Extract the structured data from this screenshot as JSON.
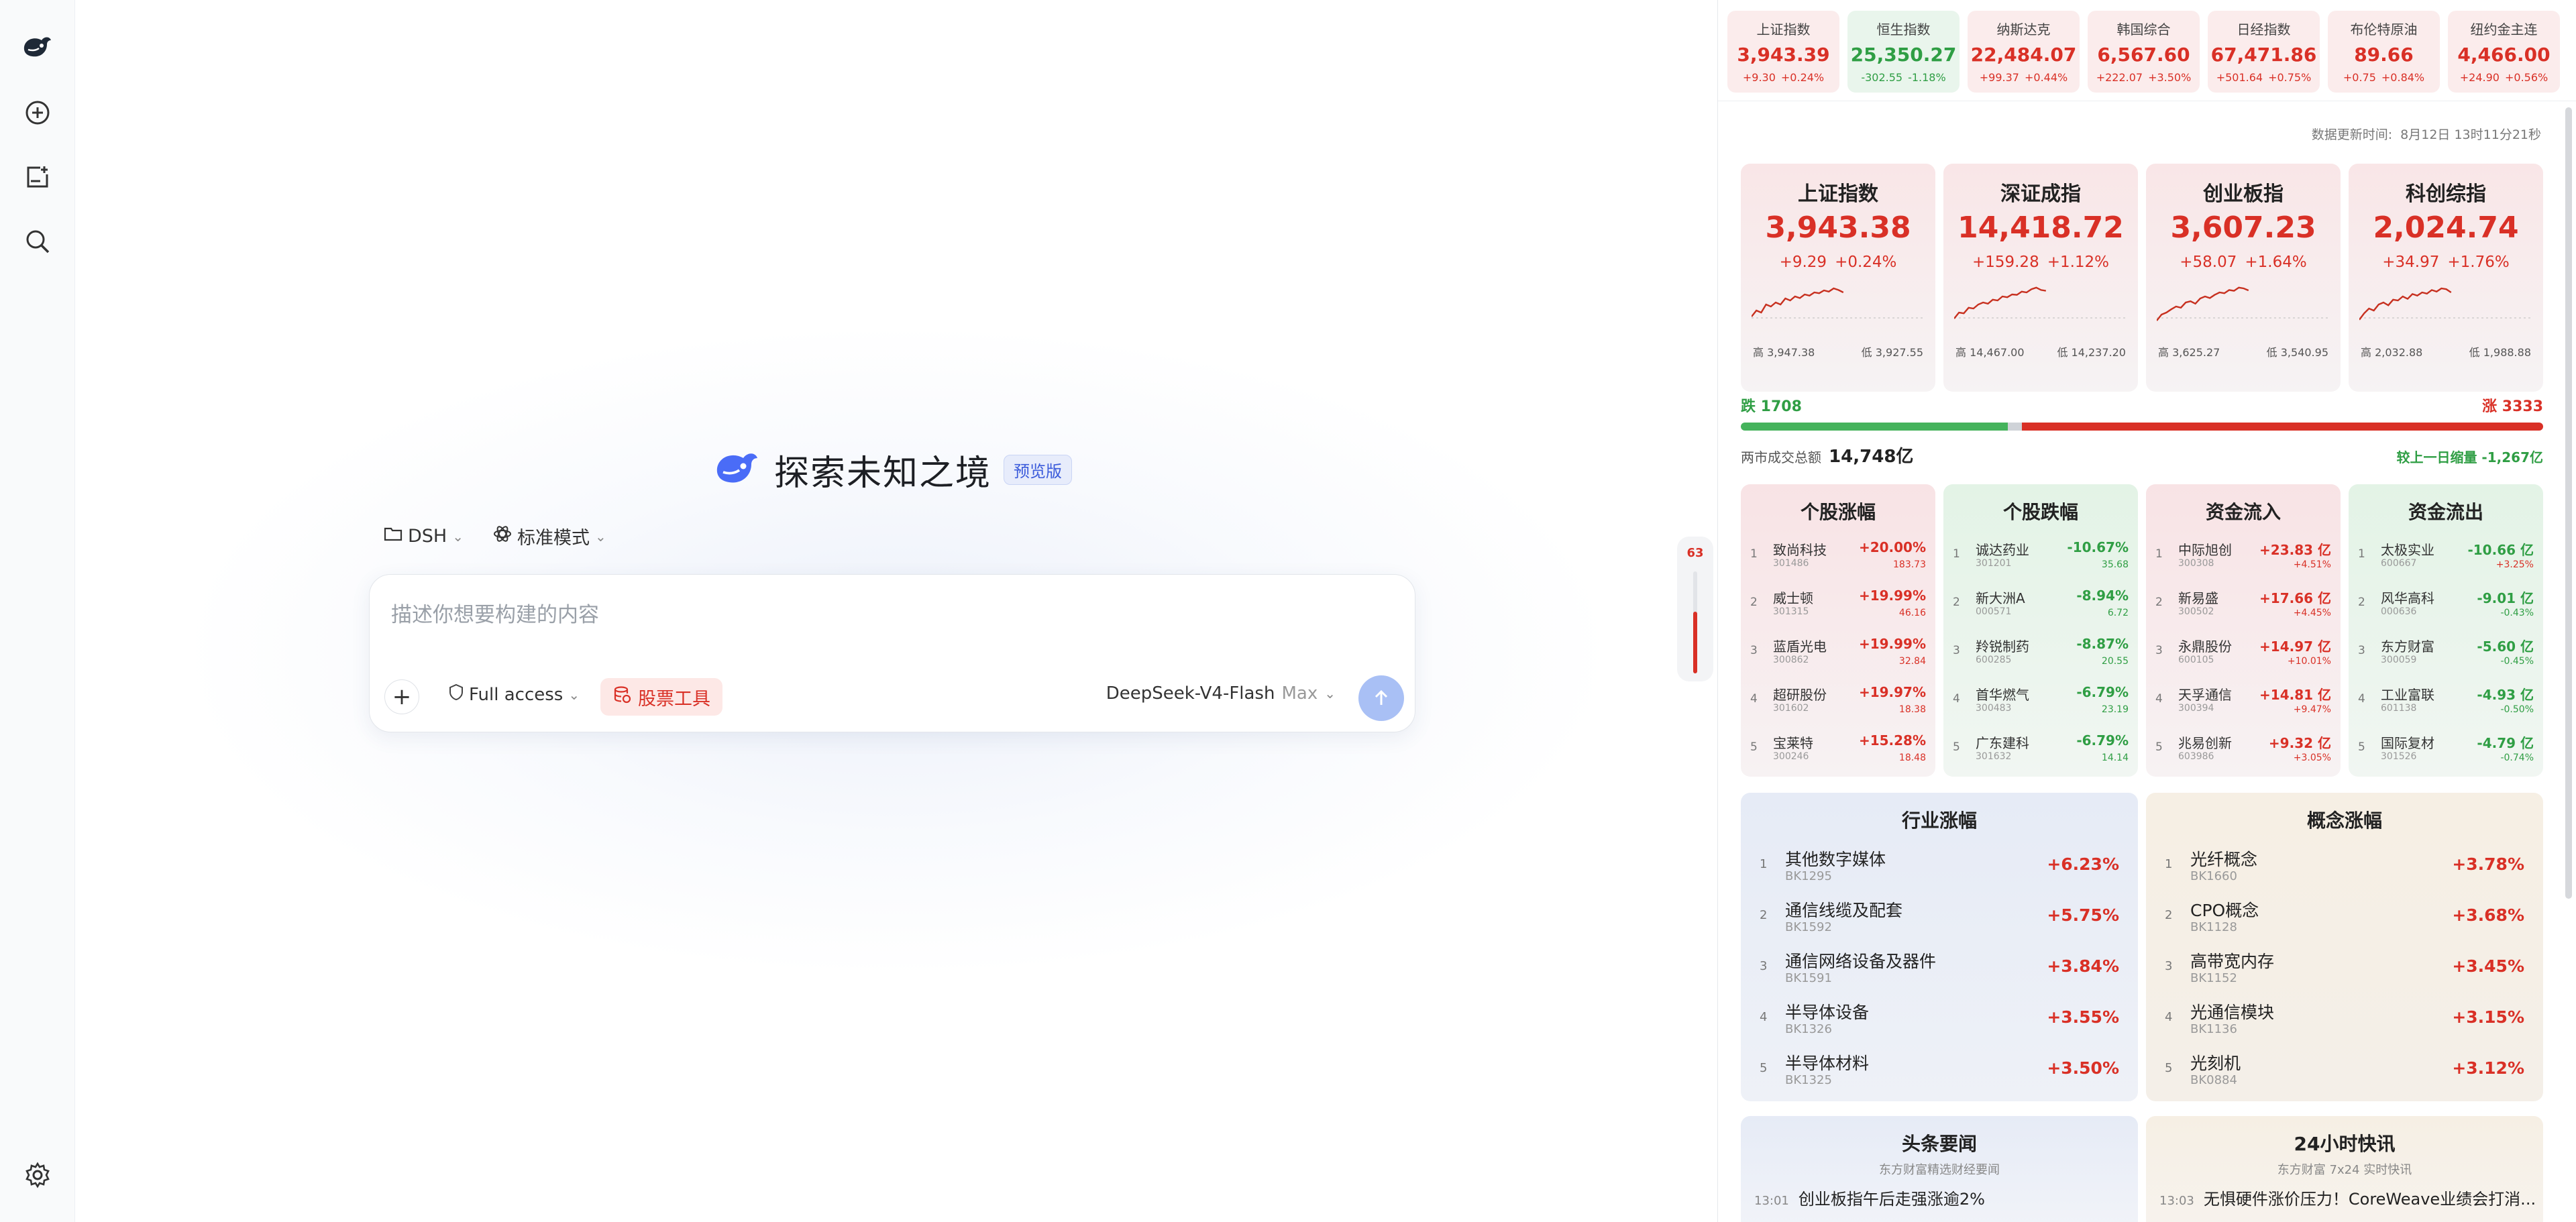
{
  "sidebar": {
    "icons": [
      "whale-logo-icon",
      "new-chat-icon",
      "new-project-icon",
      "search-icon",
      "settings-icon"
    ]
  },
  "main": {
    "title": "探索未知之境",
    "badge": "预览版",
    "workspace": "DSH",
    "mode": "标准模式",
    "input_placeholder": "描述你想要构建的内容",
    "access": "Full access",
    "tool": "股票工具",
    "model": "DeepSeek-V4-Flash",
    "model_tier": "Max",
    "scroll_count": "63"
  },
  "ticker": [
    {
      "name": "上证指数",
      "value": "3,943.39",
      "change": "+9.30",
      "pct": "+0.24%",
      "dir": "up"
    },
    {
      "name": "恒生指数",
      "value": "25,350.27",
      "change": "-302.55",
      "pct": "-1.18%",
      "dir": "dn"
    },
    {
      "name": "纳斯达克",
      "value": "22,484.07",
      "change": "+99.37",
      "pct": "+0.44%",
      "dir": "up"
    },
    {
      "name": "韩国综合",
      "value": "6,567.60",
      "change": "+222.07",
      "pct": "+3.50%",
      "dir": "up"
    },
    {
      "name": "日经指数",
      "value": "67,471.86",
      "change": "+501.64",
      "pct": "+0.75%",
      "dir": "up"
    },
    {
      "name": "布伦特原油",
      "value": "89.66",
      "change": "+0.75",
      "pct": "+0.84%",
      "dir": "up"
    },
    {
      "name": "纽约金主连",
      "value": "4,466.00",
      "change": "+24.90",
      "pct": "+0.56%",
      "dir": "up"
    }
  ],
  "update": {
    "label": "数据更新时间:",
    "time": "8月12日 13时11分21秒"
  },
  "indices": [
    {
      "name": "上证指数",
      "value": "3,943.38",
      "change": "+9.29",
      "pct": "+0.24%",
      "high": "高 3,947.38",
      "low": "低 3,927.55"
    },
    {
      "name": "深证成指",
      "value": "14,418.72",
      "change": "+159.28",
      "pct": "+1.12%",
      "high": "高 14,467.00",
      "low": "低 14,237.20"
    },
    {
      "name": "创业板指",
      "value": "3,607.23",
      "change": "+58.07",
      "pct": "+1.64%",
      "high": "高 3,625.27",
      "low": "低 3,540.95"
    },
    {
      "name": "科创综指",
      "value": "2,024.74",
      "change": "+34.97",
      "pct": "+1.76%",
      "high": "高 2,032.88",
      "low": "低 1,988.88"
    }
  ],
  "breadth": {
    "down_label": "跌 1708",
    "up_label": "涨 3333",
    "down": 1708,
    "up": 3333,
    "flat": 90,
    "turnover_label": "两市成交总额",
    "turnover": "14,748亿",
    "compare": "较上一日缩量 -1,267亿"
  },
  "movers": [
    {
      "title": "个股涨幅",
      "dir": "up",
      "items": [
        {
          "name": "致尚科技",
          "code": "301486",
          "pct": "+20.00%",
          "sub": "183.73"
        },
        {
          "name": "威士顿",
          "code": "301315",
          "pct": "+19.99%",
          "sub": "46.16"
        },
        {
          "name": "蓝盾光电",
          "code": "300862",
          "pct": "+19.99%",
          "sub": "32.84"
        },
        {
          "name": "超研股份",
          "code": "301602",
          "pct": "+19.97%",
          "sub": "18.38"
        },
        {
          "name": "宝莱特",
          "code": "300246",
          "pct": "+15.28%",
          "sub": "18.48"
        }
      ]
    },
    {
      "title": "个股跌幅",
      "dir": "dn",
      "items": [
        {
          "name": "诚达药业",
          "code": "301201",
          "pct": "-10.67%",
          "sub": "35.68"
        },
        {
          "name": "新大洲A",
          "code": "000571",
          "pct": "-8.94%",
          "sub": "6.72"
        },
        {
          "name": "羚锐制药",
          "code": "600285",
          "pct": "-8.87%",
          "sub": "20.55"
        },
        {
          "name": "首华燃气",
          "code": "300483",
          "pct": "-6.79%",
          "sub": "23.19"
        },
        {
          "name": "广东建科",
          "code": "301632",
          "pct": "-6.79%",
          "sub": "14.14"
        }
      ]
    },
    {
      "title": "资金流入",
      "dir": "up",
      "items": [
        {
          "name": "中际旭创",
          "code": "300308",
          "pct": "+23.83 亿",
          "sub": "+4.51%"
        },
        {
          "name": "新易盛",
          "code": "300502",
          "pct": "+17.66 亿",
          "sub": "+4.45%"
        },
        {
          "name": "永鼎股份",
          "code": "600105",
          "pct": "+14.97 亿",
          "sub": "+10.01%"
        },
        {
          "name": "天孚通信",
          "code": "300394",
          "pct": "+14.81 亿",
          "sub": "+9.47%"
        },
        {
          "name": "兆易创新",
          "code": "603986",
          "pct": "+9.32 亿",
          "sub": "+3.05%"
        }
      ]
    },
    {
      "title": "资金流出",
      "dir": "dn",
      "items": [
        {
          "name": "太极实业",
          "code": "600667",
          "pct": "-10.66 亿",
          "sub": "+3.25%"
        },
        {
          "name": "风华高科",
          "code": "000636",
          "pct": "-9.01 亿",
          "sub": "-0.43%"
        },
        {
          "name": "东方财富",
          "code": "300059",
          "pct": "-5.60 亿",
          "sub": "-0.45%"
        },
        {
          "name": "工业富联",
          "code": "601138",
          "pct": "-4.93 亿",
          "sub": "-0.50%"
        },
        {
          "name": "国际复材",
          "code": "301526",
          "pct": "-4.79 亿",
          "sub": "-0.74%"
        }
      ]
    }
  ],
  "boards": [
    {
      "title": "行业涨幅",
      "kind": "ind",
      "items": [
        {
          "name": "其他数字媒体",
          "code": "BK1295",
          "pct": "+6.23%"
        },
        {
          "name": "通信线缆及配套",
          "code": "BK1592",
          "pct": "+5.75%"
        },
        {
          "name": "通信网络设备及器件",
          "code": "BK1591",
          "pct": "+3.84%"
        },
        {
          "name": "半导体设备",
          "code": "BK1326",
          "pct": "+3.55%"
        },
        {
          "name": "半导体材料",
          "code": "BK1325",
          "pct": "+3.50%"
        }
      ]
    },
    {
      "title": "概念涨幅",
      "kind": "con",
      "items": [
        {
          "name": "光纤概念",
          "code": "BK1660",
          "pct": "+3.78%"
        },
        {
          "name": "CPO概念",
          "code": "BK1128",
          "pct": "+3.68%"
        },
        {
          "name": "高带宽内存",
          "code": "BK1152",
          "pct": "+3.45%"
        },
        {
          "name": "光通信模块",
          "code": "BK1136",
          "pct": "+3.15%"
        },
        {
          "name": "光刻机",
          "code": "BK0884",
          "pct": "+3.12%"
        }
      ]
    }
  ],
  "news": [
    {
      "title": "头条要闻",
      "sub": "东方财富精选财经要闻",
      "time": "13:01",
      "headline": "创业板指午后走强涨逾2%"
    },
    {
      "title": "24小时快讯",
      "sub": "东方财富 7x24 实时快讯",
      "time": "13:03",
      "headline": "无惧硬件涨价压力！CoreWeave业绩会打消..."
    }
  ]
}
